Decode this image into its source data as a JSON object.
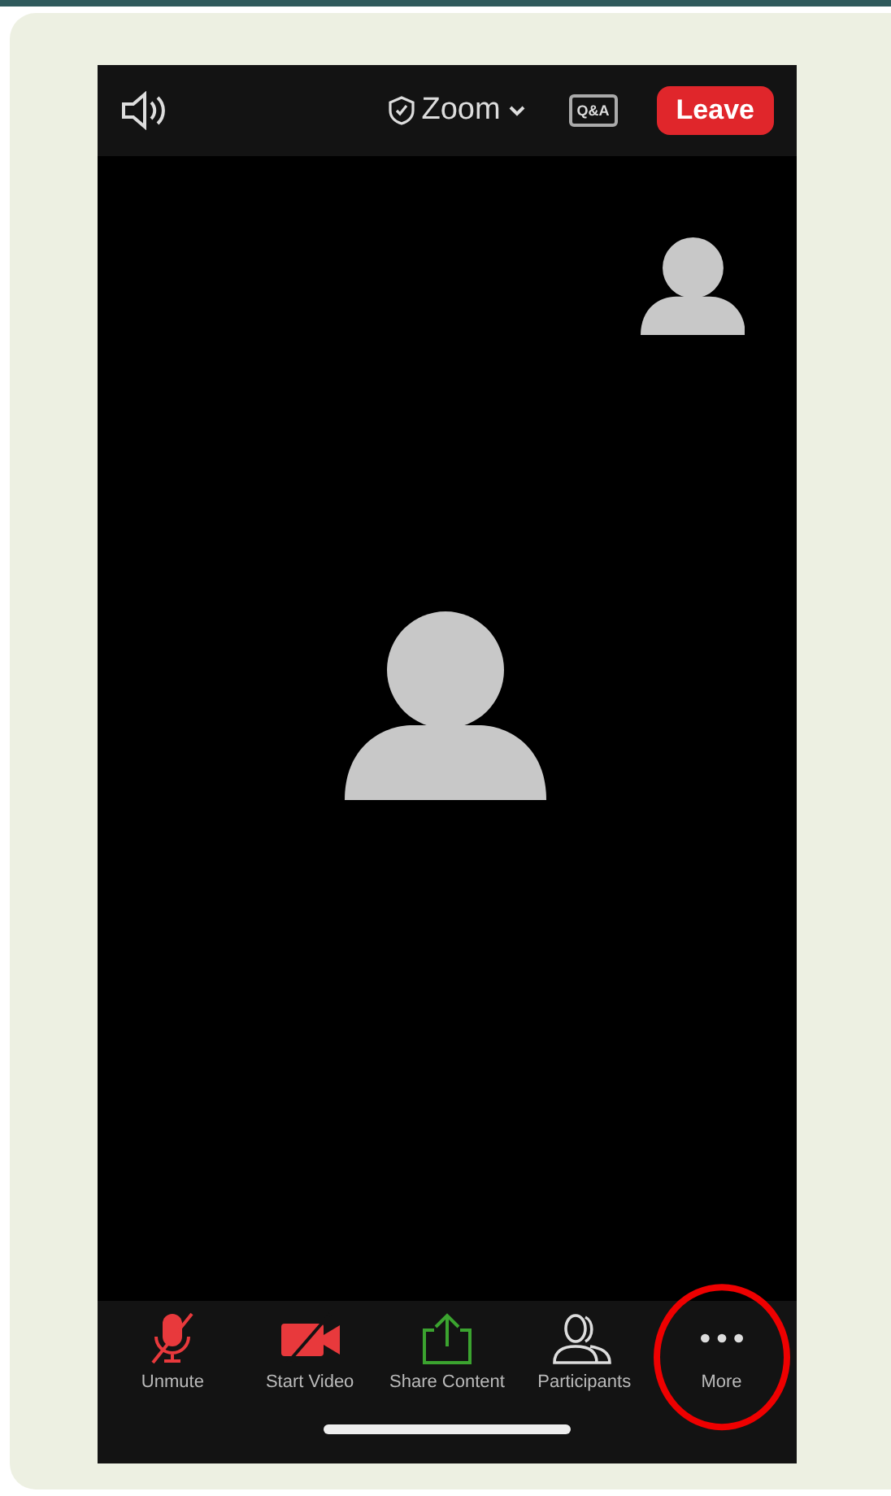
{
  "top_bar": {
    "meeting_name": "Zoom",
    "qa_badge": "Q&A",
    "leave_button": "Leave"
  },
  "toolbar": [
    {
      "kind": "mic",
      "label": "Unmute",
      "off": true,
      "highlighted": false
    },
    {
      "kind": "video",
      "label": "Start Video",
      "off": true,
      "highlighted": false
    },
    {
      "kind": "share",
      "label": "Share Content",
      "off": false,
      "highlighted": false
    },
    {
      "kind": "participants",
      "label": "Participants",
      "off": false,
      "highlighted": false
    },
    {
      "kind": "more",
      "label": "More",
      "off": false,
      "highlighted": true
    }
  ]
}
